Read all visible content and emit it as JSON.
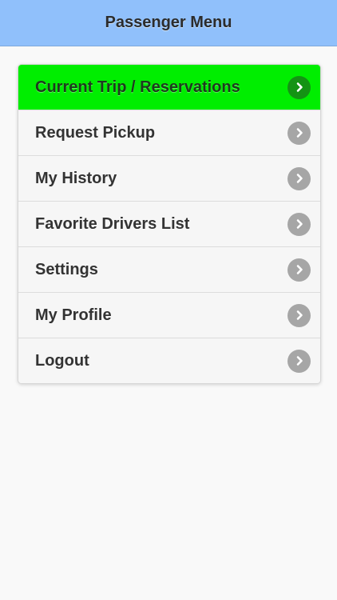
{
  "header": {
    "title": "Passenger Menu"
  },
  "menu": {
    "items": [
      {
        "label": "Current Trip / Reservations",
        "active": true
      },
      {
        "label": "Request Pickup",
        "active": false
      },
      {
        "label": "My History",
        "active": false
      },
      {
        "label": "Favorite Drivers List",
        "active": false
      },
      {
        "label": "Settings",
        "active": false
      },
      {
        "label": "My Profile",
        "active": false
      },
      {
        "label": "Logout",
        "active": false
      }
    ]
  },
  "icons": {
    "item_arrow": "chevron-right-icon"
  },
  "colors": {
    "header_bg": "#90c0fb",
    "active_item_bg": "#00ee00",
    "active_chevron": "#149314",
    "chevron": "#a6a6a6"
  }
}
